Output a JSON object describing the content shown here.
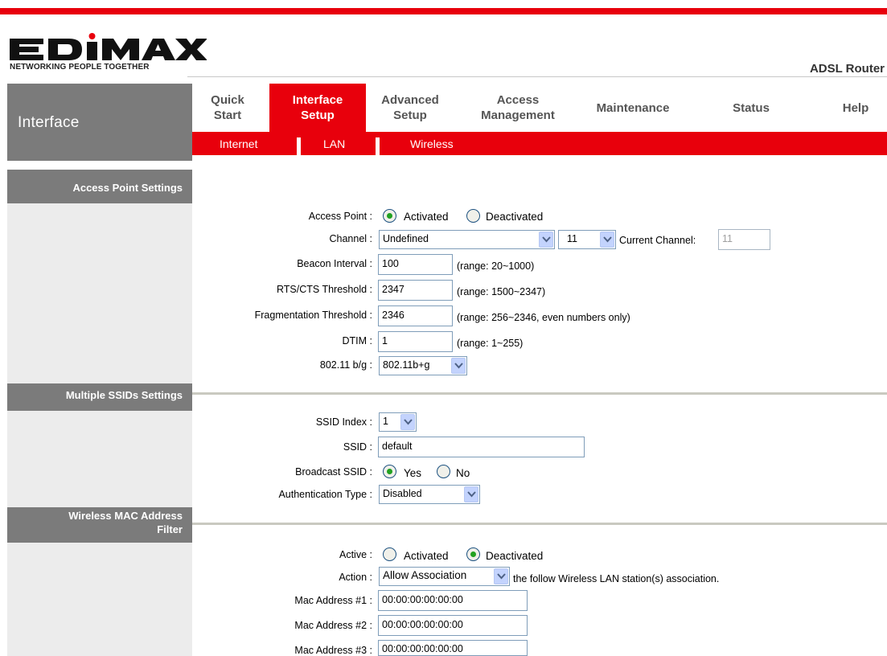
{
  "brand": {
    "logo": "EDIMAX",
    "tagline": "NETWORKING PEOPLE TOGETHER",
    "product": "ADSL Router"
  },
  "nav": {
    "section": "Interface",
    "tabs": [
      {
        "line1": "Quick",
        "line2": "Start"
      },
      {
        "line1": "Interface",
        "line2": "Setup"
      },
      {
        "line1": "Advanced",
        "line2": "Setup"
      },
      {
        "line1": "Access",
        "line2": "Management"
      },
      {
        "line1": "Maintenance",
        "line2": ""
      },
      {
        "line1": "Status",
        "line2": ""
      },
      {
        "line1": "Help",
        "line2": ""
      }
    ],
    "subtabs": [
      "Internet",
      "LAN",
      "Wireless"
    ]
  },
  "ap": {
    "heading": "Access Point Settings",
    "access_point_label": "Access Point :",
    "activated": "Activated",
    "deactivated": "Deactivated",
    "channel_label": "Channel :",
    "channel_region": "Undefined",
    "channel_number": "11",
    "current_channel_label": "Current Channel:",
    "current_channel_value": "11",
    "beacon_label": "Beacon Interval :",
    "beacon_value": "100",
    "beacon_hint": "(range: 20~1000)",
    "rts_label": "RTS/CTS Threshold :",
    "rts_value": "2347",
    "rts_hint": "(range: 1500~2347)",
    "frag_label": "Fragmentation Threshold :",
    "frag_value": "2346",
    "frag_hint": "(range: 256~2346, even numbers only)",
    "dtim_label": "DTIM :",
    "dtim_value": "1",
    "dtim_hint": "(range: 1~255)",
    "mode_label": "802.11 b/g :",
    "mode_value": "802.11b+g"
  },
  "ssid": {
    "heading": "Multiple SSIDs Settings",
    "index_label": "SSID Index :",
    "index_value": "1",
    "ssid_label": "SSID :",
    "ssid_value": "default",
    "broadcast_label": "Broadcast SSID :",
    "yes": "Yes",
    "no": "No",
    "auth_label": "Authentication Type :",
    "auth_value": "Disabled"
  },
  "mac": {
    "heading_line1": "Wireless MAC Address",
    "heading_line2": "Filter",
    "active_label": "Active :",
    "activated": "Activated",
    "deactivated": "Deactivated",
    "action_label": "Action :",
    "action_value": "Allow Association",
    "action_suffix": "the follow Wireless LAN station(s) association.",
    "addresses": [
      {
        "label": "Mac Address #1 :",
        "value": "00:00:00:00:00:00"
      },
      {
        "label": "Mac Address #2 :",
        "value": "00:00:00:00:00:00"
      },
      {
        "label": "Mac Address #3 :",
        "value": "00:00:00:00:00:00"
      }
    ]
  },
  "colors": {
    "accent": "#e8000c",
    "nav_grey": "#7b7b7b",
    "sidebar": "#ececec"
  }
}
